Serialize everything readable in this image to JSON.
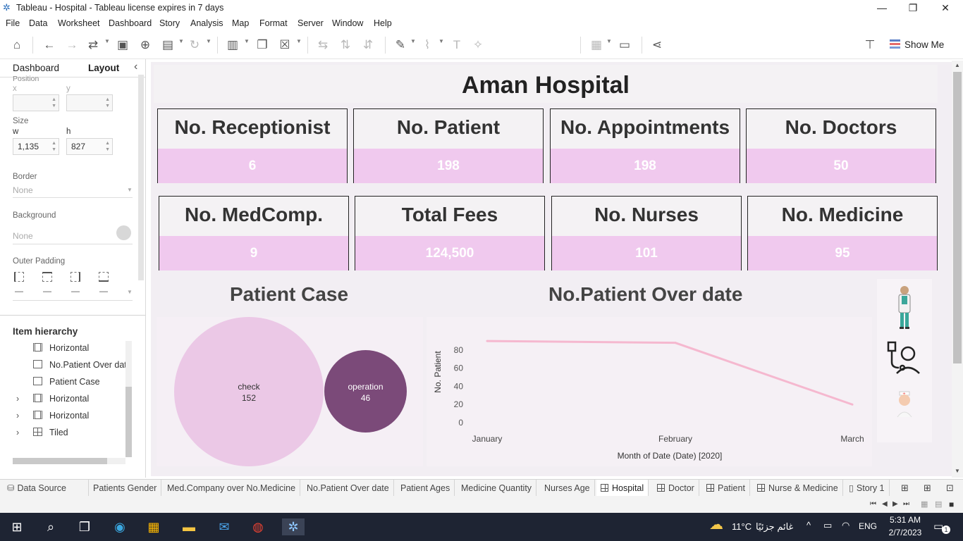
{
  "window": {
    "title": "Tableau - Hospital - Tableau license expires in 7 days",
    "minimize": "—",
    "restore": "❐",
    "close": "✕"
  },
  "menu": [
    "File",
    "Data",
    "Worksheet",
    "Dashboard",
    "Story",
    "Analysis",
    "Map",
    "Format",
    "Server",
    "Window",
    "Help"
  ],
  "toolbar": {
    "show_me_label": "Show Me"
  },
  "left_pane": {
    "tab_dashboard": "Dashboard",
    "tab_layout": "Layout",
    "collapse_icon": "‹",
    "position_label": "Position",
    "x_label": "x",
    "y_label": "y",
    "size_label": "Size",
    "w_label": "w",
    "h_label": "h",
    "w_value": "1,135",
    "h_value": "827",
    "border_label": "Border",
    "border_value": "None",
    "background_label": "Background",
    "background_value": "None",
    "outer_padding_label": "Outer Padding",
    "item_hierarchy_label": "Item hierarchy",
    "hierarchy": [
      {
        "label": "Horizontal",
        "expandable": false
      },
      {
        "label": "No.Patient Over dat",
        "expandable": false
      },
      {
        "label": "Patient Case",
        "expandable": false
      },
      {
        "label": "Horizontal",
        "expandable": true
      },
      {
        "label": "Horizontal",
        "expandable": true
      },
      {
        "label": "Tiled",
        "expandable": true
      }
    ]
  },
  "dashboard": {
    "title": "Aman Hospital",
    "kpis_row1": [
      {
        "title": "No. Receptionist",
        "value": "6"
      },
      {
        "title": "No. Patient",
        "value": "198"
      },
      {
        "title": "No. Appointments",
        "value": "198"
      },
      {
        "title": "No. Doctors",
        "value": "50"
      }
    ],
    "kpis_row2": [
      {
        "title": "No. MedComp.",
        "value": "9"
      },
      {
        "title": "Total Fees",
        "value": "124,500"
      },
      {
        "title": "No. Nurses",
        "value": "101"
      },
      {
        "title": "No. Medicine",
        "value": "95"
      }
    ],
    "patient_case_title": "Patient Case",
    "line_title": "No.Patient Over date"
  },
  "chart_data": [
    {
      "type": "bubble",
      "title": "Patient Case",
      "categories": [
        "check",
        "operation"
      ],
      "values": [
        152,
        46
      ],
      "colors": [
        "#ebc8e6",
        "#7b4a79"
      ]
    },
    {
      "type": "line",
      "title": "No.Patient Over date",
      "x": [
        "January",
        "February",
        "March"
      ],
      "y": [
        90,
        88,
        20
      ],
      "xlabel": "Month of Date (Date) [2020]",
      "ylabel": "No. Patient",
      "yticks": [
        0,
        20,
        40,
        60,
        80
      ],
      "ylim": [
        0,
        100
      ],
      "color": "#f5b8cf"
    }
  ],
  "sheet_tabs": [
    {
      "label": "Data Source",
      "kind": "source",
      "active": false
    },
    {
      "label": "Patients Gender",
      "kind": "sheet",
      "active": false
    },
    {
      "label": "Med.Company over No.Medicine",
      "kind": "sheet",
      "active": false
    },
    {
      "label": "No.Patient Over date",
      "kind": "sheet",
      "active": false
    },
    {
      "label": "Patient Ages",
      "kind": "sheet",
      "active": false
    },
    {
      "label": "Medicine Quantity",
      "kind": "sheet",
      "active": false
    },
    {
      "label": "Nurses Age",
      "kind": "sheet",
      "active": false
    },
    {
      "label": "Hospital",
      "kind": "dashboard",
      "active": true
    },
    {
      "label": "Doctor",
      "kind": "dashboard",
      "active": false
    },
    {
      "label": "Patient",
      "kind": "dashboard",
      "active": false
    },
    {
      "label": "Nurse & Medicine",
      "kind": "dashboard",
      "active": false
    },
    {
      "label": "Story 1",
      "kind": "story",
      "active": false
    }
  ],
  "taskbar": {
    "weather_temp": "11°C",
    "weather_text": "غائم جزئيًا",
    "language": "ENG",
    "time": "5:31 AM",
    "date": "2/7/2023",
    "notification_count": "1"
  }
}
